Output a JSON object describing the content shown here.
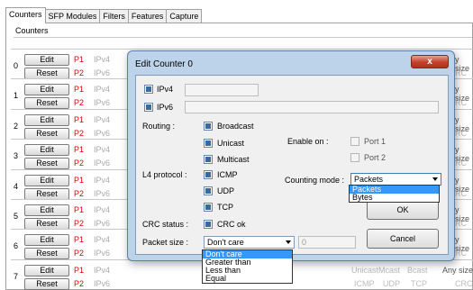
{
  "tabs": [
    "Counters",
    "SFP Modules",
    "Filters",
    "Features",
    "Capture"
  ],
  "group_label": "Counters",
  "rows": [
    {
      "n": "0",
      "edit": "Edit",
      "reset": "Reset",
      "p1": "P1",
      "p2": "P2",
      "ipv4": "IPv4",
      "ipv6": "IPv6",
      "r1": "y size",
      "r2": "RC"
    },
    {
      "n": "1",
      "edit": "Edit",
      "reset": "Reset",
      "p1": "P1",
      "p2": "P2",
      "ipv4": "IPv4",
      "ipv6": "IPv6",
      "r1": "y size",
      "r2": "RC"
    },
    {
      "n": "2",
      "edit": "Edit",
      "reset": "Reset",
      "p1": "P1",
      "p2": "P2",
      "ipv4": "IPv4",
      "ipv6": "IPv6",
      "r1": "y size",
      "r2": "RC"
    },
    {
      "n": "3",
      "edit": "Edit",
      "reset": "Reset",
      "p1": "P1",
      "p2": "P2",
      "ipv4": "IPv4",
      "ipv6": "IPv6",
      "r1": "y size",
      "r2": "RC"
    },
    {
      "n": "4",
      "edit": "Edit",
      "reset": "Reset",
      "p1": "P1",
      "p2": "P2",
      "ipv4": "IPv4",
      "ipv6": "IPv6",
      "r1": "y size",
      "r2": "RC"
    },
    {
      "n": "5",
      "edit": "Edit",
      "reset": "Reset",
      "p1": "P1",
      "p2": "P2",
      "ipv4": "IPv4",
      "ipv6": "IPv6",
      "r1": "y size",
      "r2": "RC"
    },
    {
      "n": "6",
      "edit": "Edit",
      "reset": "Reset",
      "p1": "P1",
      "p2": "P2",
      "ipv4": "IPv4",
      "ipv6": "IPv6",
      "r1": "y size",
      "r2": "RC"
    },
    {
      "n": "7",
      "edit": "Edit",
      "reset": "Reset",
      "p1": "P1",
      "p2": "P2",
      "ipv4": "IPv4",
      "ipv6": "IPv6",
      "r1": "Any size",
      "r2": "CRC"
    }
  ],
  "row7_extra": {
    "unicast": "Unicast",
    "multicast": "Mcast",
    "broadcast": "Bcast",
    "icmp": "ICMP",
    "udp": "UDP",
    "tcp": "TCP"
  },
  "dialog": {
    "title": "Edit Counter 0",
    "close": "x",
    "ipv4": "IPv4",
    "ipv6": "IPv6",
    "routing_label": "Routing :",
    "broadcast": "Broadcast",
    "unicast": "Unicast",
    "multicast": "Multicast",
    "l4_label": "L4 protocol :",
    "icmp": "ICMP",
    "udp": "UDP",
    "tcp": "TCP",
    "crc_label": "CRC status :",
    "crc_ok": "CRC ok",
    "packet_size_label": "Packet size :",
    "packet_size_value": "Don't care",
    "packet_size_number": "0",
    "packet_size_options": [
      "Don't care",
      "Greater than",
      "Less than",
      "Equal"
    ],
    "enable_label": "Enable on :",
    "port1": "Port 1",
    "port2": "Port 2",
    "counting_label": "Counting mode :",
    "counting_value": "Packets",
    "counting_options": [
      "Packets",
      "Bytes"
    ],
    "ok": "OK",
    "cancel": "Cancel"
  },
  "colors": {
    "port_red": "#d00000",
    "highlight": "#3399ff",
    "checked": "#3b6aa3"
  }
}
